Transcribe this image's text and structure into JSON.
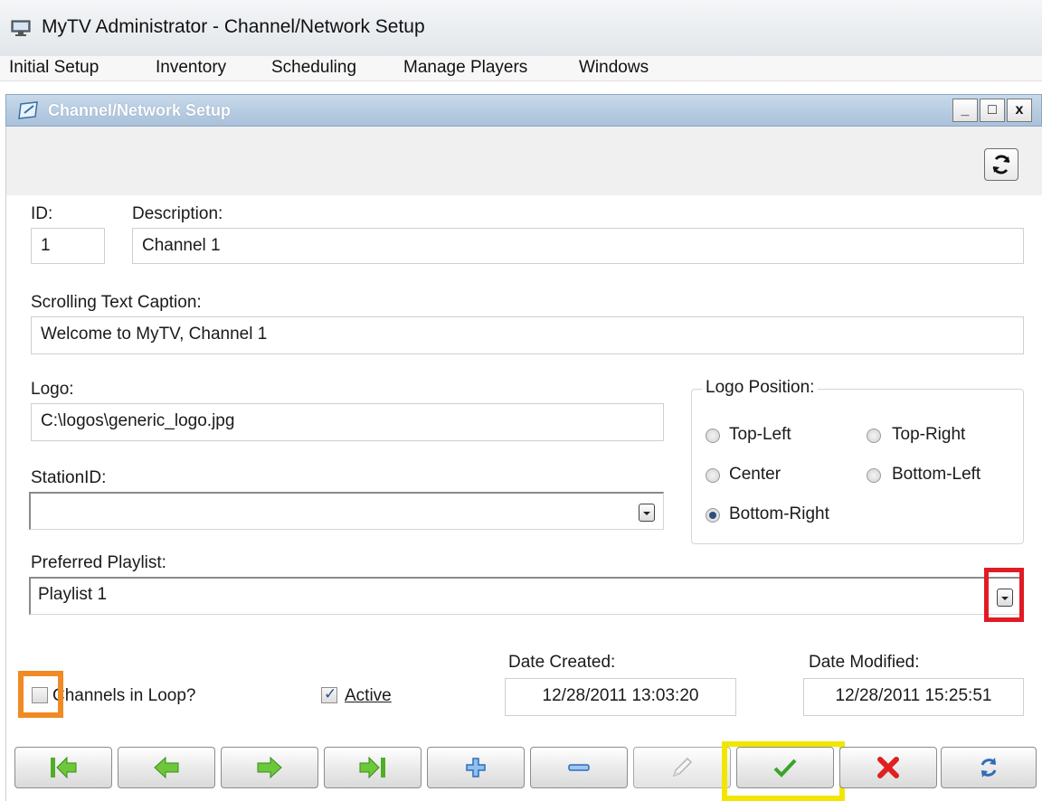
{
  "app": {
    "title": "MyTV Administrator - Channel/Network Setup"
  },
  "menu": {
    "items": [
      "Initial Setup",
      "Inventory",
      "Scheduling",
      "Manage Players",
      "Windows"
    ]
  },
  "child_window": {
    "title": "Channel/Network Setup",
    "minimize": "_",
    "maximize": "□",
    "close": "x"
  },
  "form": {
    "id_label": "ID:",
    "id_value": "1",
    "description_label": "Description:",
    "description_value": "Channel 1",
    "caption_label": "Scrolling Text Caption:",
    "caption_value": "Welcome to MyTV, Channel 1",
    "logo_label": "Logo:",
    "logo_value": "C:\\logos\\generic_logo.jpg",
    "stationid_label": "StationID:",
    "stationid_value": "",
    "logo_position": {
      "label": "Logo Position:",
      "options": [
        "Top-Left",
        "Top-Right",
        "Center",
        "Bottom-Left",
        "Bottom-Right"
      ],
      "selected": "Bottom-Right"
    },
    "playlist_label": "Preferred Playlist:",
    "playlist_value": "Playlist 1",
    "channels_in_loop_label": "Channels in Loop?",
    "channels_in_loop_checked": false,
    "active_label": "Active",
    "active_checked": true,
    "date_created_label": "Date Created:",
    "date_created_value": "12/28/2011 13:03:20",
    "date_modified_label": "Date Modified:",
    "date_modified_value": "12/28/2011 15:25:51"
  },
  "nav_buttons": [
    {
      "name": "first-record-button",
      "icon": "first-arrow-icon"
    },
    {
      "name": "previous-record-button",
      "icon": "left-arrow-icon"
    },
    {
      "name": "next-record-button",
      "icon": "right-arrow-icon"
    },
    {
      "name": "last-record-button",
      "icon": "last-arrow-icon"
    },
    {
      "name": "add-record-button",
      "icon": "plus-icon"
    },
    {
      "name": "delete-record-button",
      "icon": "minus-icon"
    },
    {
      "name": "edit-record-button",
      "icon": "pencil-icon"
    },
    {
      "name": "save-button",
      "icon": "checkmark-icon"
    },
    {
      "name": "cancel-button",
      "icon": "red-x-icon"
    },
    {
      "name": "refresh-button",
      "icon": "refresh-icon"
    }
  ],
  "highlights": {
    "playlist_dropdown": "#e01b24",
    "channels_in_loop_checkbox": "#f08a24",
    "save_button": "#f2e600"
  },
  "colors": {
    "title_bar": "#a9c1da",
    "nav_arrow_green": "#5cbf2a",
    "plus_blue": "#3b7fd0",
    "cancel_red": "#e02020"
  }
}
